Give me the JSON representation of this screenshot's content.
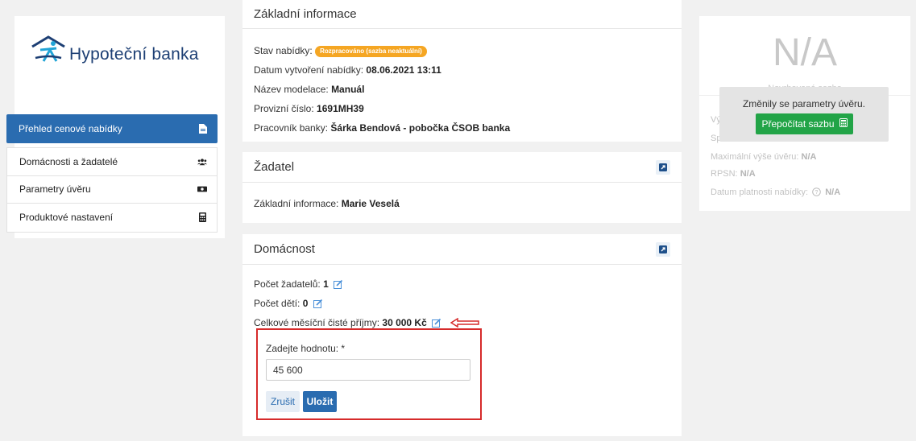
{
  "brand": {
    "name": "Hypoteční banka"
  },
  "sidebar": {
    "active": {
      "label": "Přehled cenové nabídky",
      "icon": "document-icon"
    },
    "items": [
      {
        "label": "Domácnosti a žadatelé",
        "icon": "users-icon"
      },
      {
        "label": "Parametry úvěru",
        "icon": "money-icon"
      },
      {
        "label": "Produktové nastavení",
        "icon": "calculator-icon"
      }
    ]
  },
  "basic": {
    "title": "Základní informace",
    "status_label": "Stav nabídky:",
    "status_value": "Rozpracováno (sazba neaktuální)",
    "created_label": "Datum vytvoření nabídky:",
    "created_value": "08.06.2021 13:11",
    "model_label": "Název modelace:",
    "model_value": "Manuál",
    "op_label": "Provizní číslo:",
    "op_value": "1691MH39",
    "worker_label": "Pracovník banky:",
    "worker_value": "Šárka Bendová - pobočka ČSOB banka"
  },
  "applicant": {
    "title": "Žadatel",
    "info_label": "Základní informace:",
    "info_value": "Marie Veselá"
  },
  "household": {
    "title": "Domácnost",
    "applicants_label": "Počet žadatelů:",
    "applicants_value": "1",
    "children_label": "Počet dětí:",
    "children_value": "0",
    "income_label": "Celkové měsíční čisté příjmy:",
    "income_value": "30 000 Kč",
    "edit": {
      "label": "Zadejte hodnotu: *",
      "value": "45 600",
      "cancel": "Zrušit",
      "save": "Uložit"
    }
  },
  "summary": {
    "rate": "N/A",
    "rate_label": "Navrhovaná sazba",
    "rows": [
      {
        "label": "Vý",
        "value": ""
      },
      {
        "label": "Sp",
        "value": ""
      },
      {
        "label": "Maximální výše úvěru:",
        "value": "N/A"
      },
      {
        "label": "RPSN:",
        "value": "N/A"
      },
      {
        "label": "Datum platnosti nabídky:",
        "value": "N/A"
      }
    ],
    "notice": "Změnily se parametry úvěru.",
    "recalc": "Přepočítat sazbu"
  },
  "colors": {
    "primary": "#2a6cb0",
    "warning": "#f5a623",
    "success": "#22a447",
    "highlight": "#d62b2b"
  }
}
